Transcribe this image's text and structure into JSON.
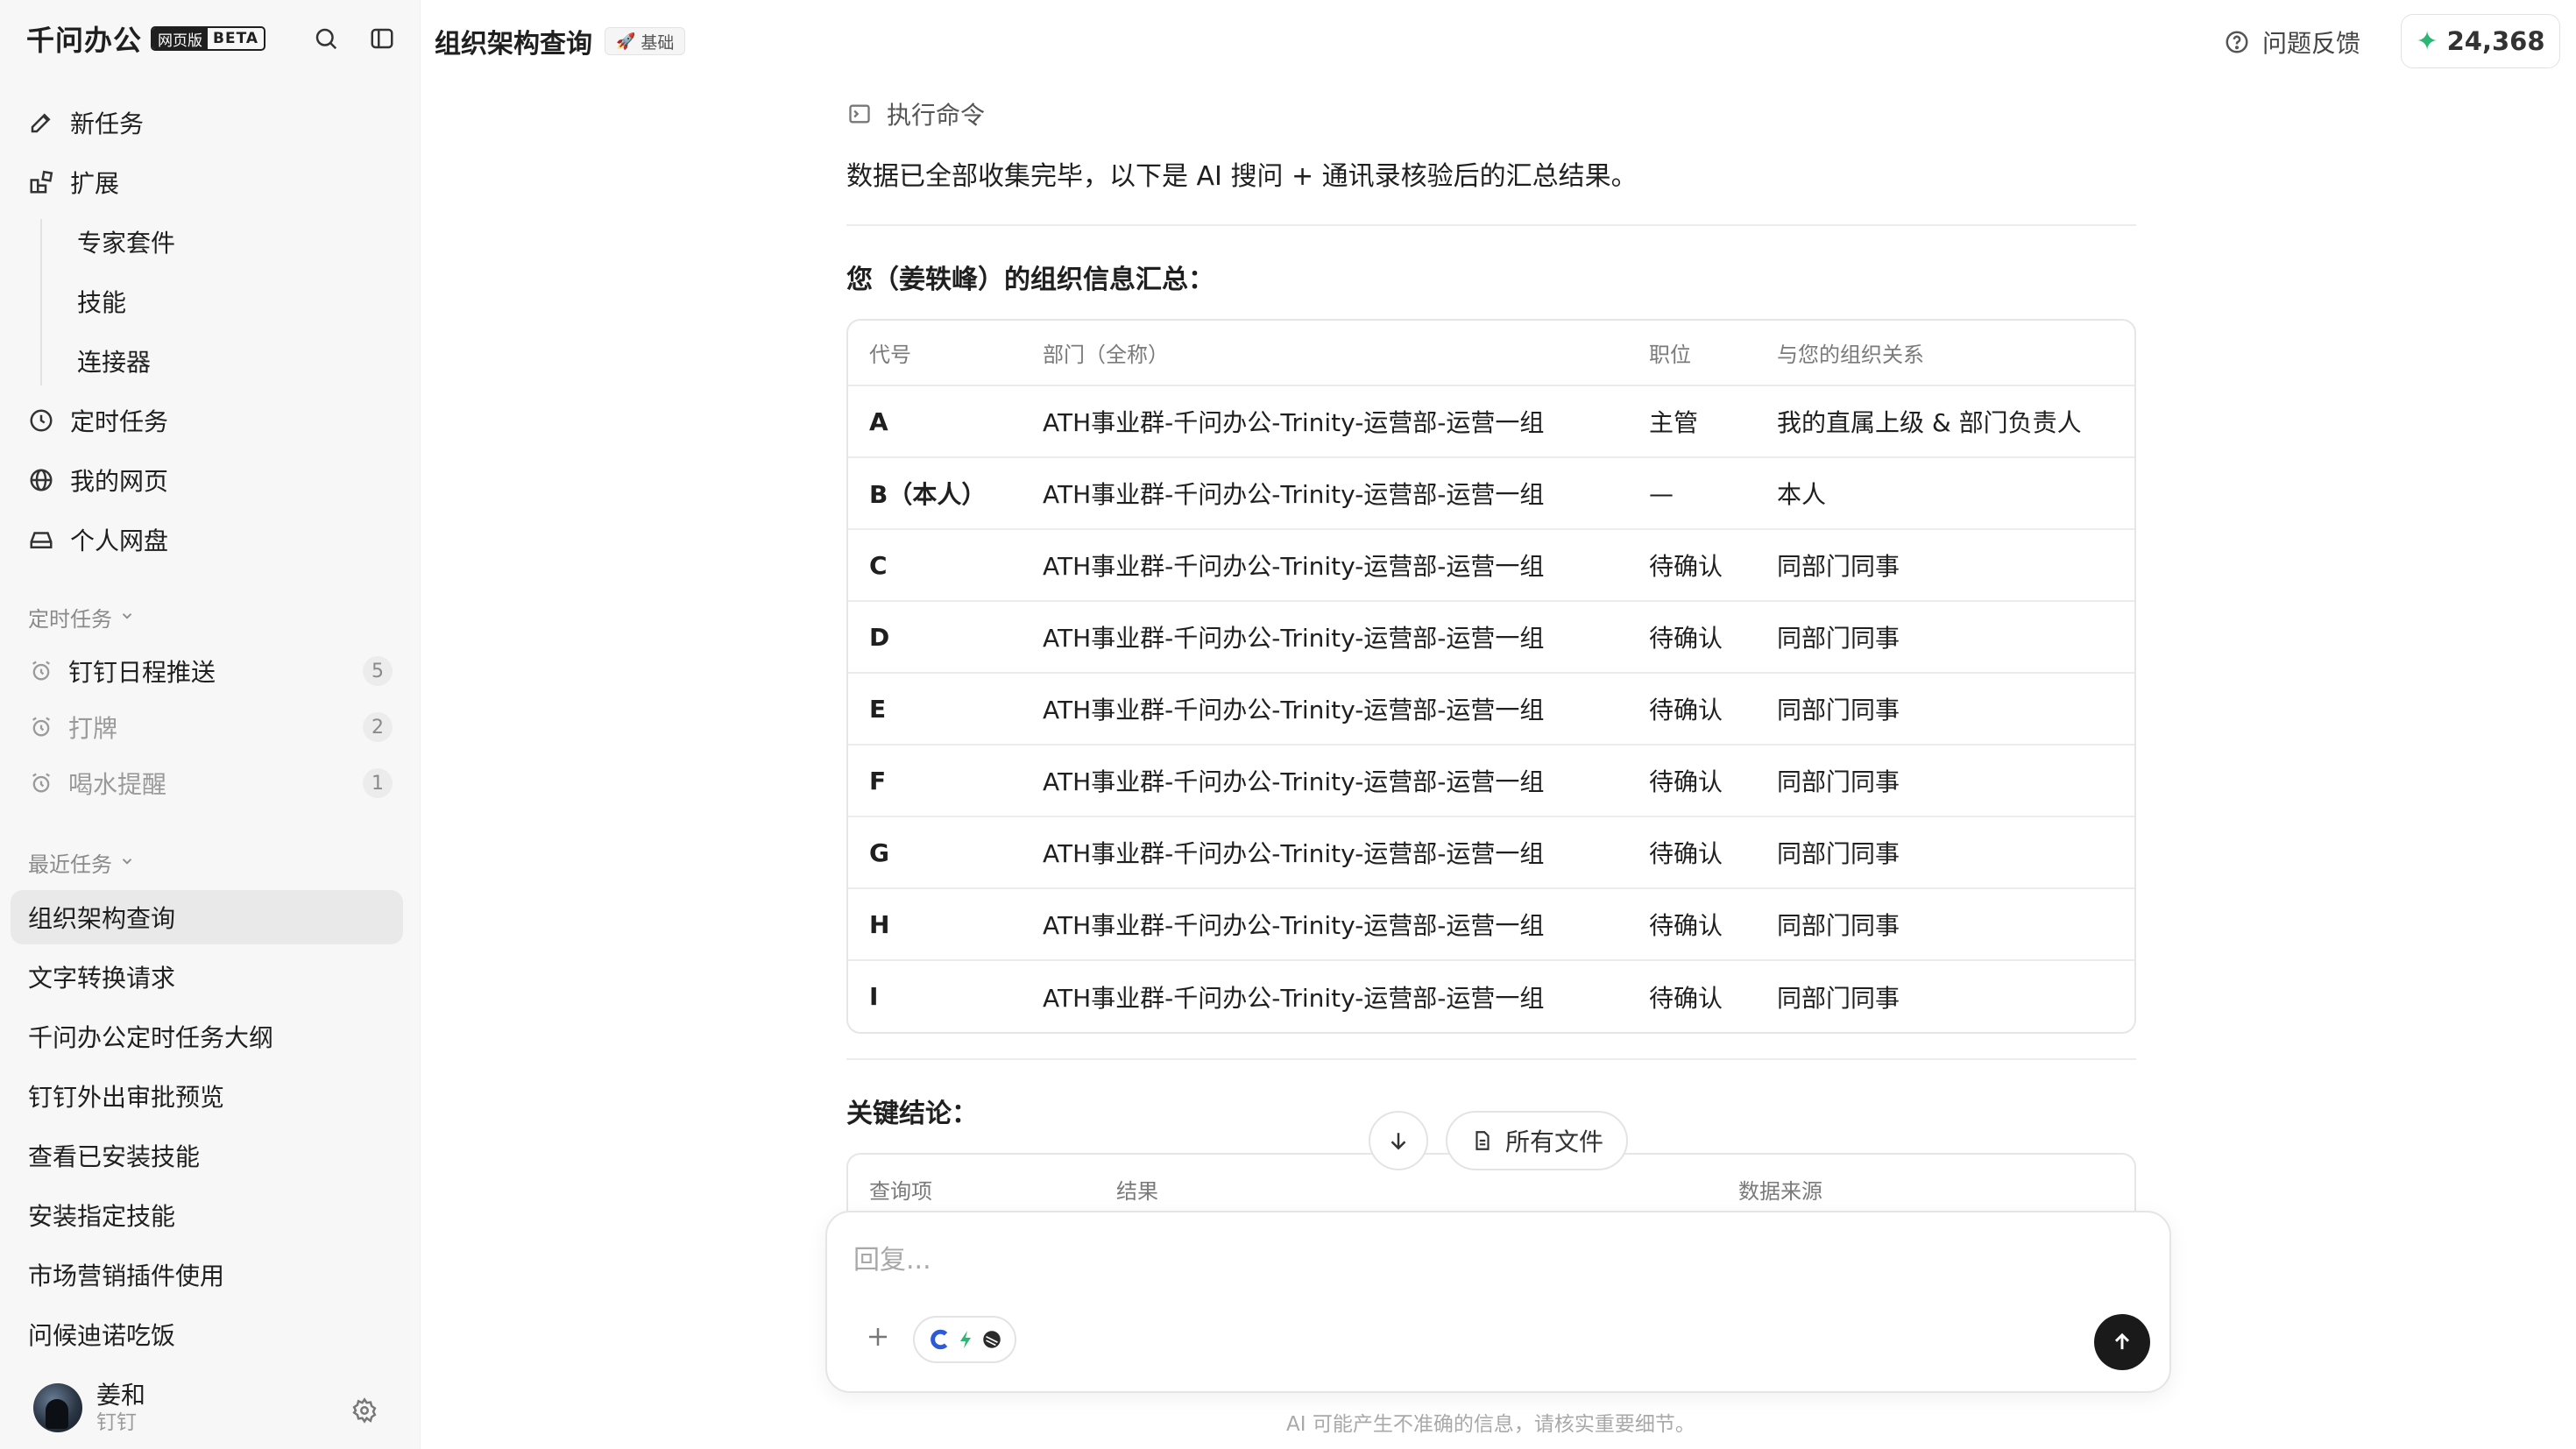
{
  "brand": {
    "name": "千问办公",
    "badge_left": "网页版",
    "badge_right": "BETA"
  },
  "nav": {
    "new_task": "新任务",
    "extensions": "扩展",
    "sub_items": [
      "专家套件",
      "技能",
      "连接器"
    ],
    "scheduled": "定时任务",
    "my_pages": "我的网页",
    "drive": "个人网盘"
  },
  "scheduled_section": {
    "title": "定时任务",
    "items": [
      {
        "label": "钉钉日程推送",
        "count": "5"
      },
      {
        "label": "打牌",
        "count": "2"
      },
      {
        "label": "喝水提醒",
        "count": "1"
      }
    ]
  },
  "recent_section": {
    "title": "最近任务",
    "items": [
      "组织架构查询",
      "文字转换请求",
      "千问办公定时任务大纲",
      "钉钉外出审批预览",
      "查看已安装技能",
      "安装指定技能",
      "市场营销插件使用",
      "问候迪诺吃饭"
    ]
  },
  "user": {
    "name": "姜和",
    "sub": "钉钉"
  },
  "header": {
    "title": "组织架构查询",
    "tag": "基础",
    "feedback": "问题反馈",
    "credits": "24,368"
  },
  "content": {
    "command_label": "执行命令",
    "intro": "数据已全部收集完毕，以下是 AI 搜问 + 通讯录核验后的汇总结果。",
    "summary_title": "您（姜轶峰）的组织信息汇总：",
    "table": {
      "headers": [
        "代号",
        "部门（全称）",
        "职位",
        "与您的组织关系"
      ],
      "rows": [
        [
          "A",
          "ATH事业群-千问办公-Trinity-运营部-运营一组",
          "主管",
          "我的直属上级 & 部门负责人"
        ],
        [
          "B（本人）",
          "ATH事业群-千问办公-Trinity-运营部-运营一组",
          "—",
          "本人"
        ],
        [
          "C",
          "ATH事业群-千问办公-Trinity-运营部-运营一组",
          "待确认",
          "同部门同事"
        ],
        [
          "D",
          "ATH事业群-千问办公-Trinity-运营部-运营一组",
          "待确认",
          "同部门同事"
        ],
        [
          "E",
          "ATH事业群-千问办公-Trinity-运营部-运营一组",
          "待确认",
          "同部门同事"
        ],
        [
          "F",
          "ATH事业群-千问办公-Trinity-运营部-运营一组",
          "待确认",
          "同部门同事"
        ],
        [
          "G",
          "ATH事业群-千问办公-Trinity-运营部-运营一组",
          "待确认",
          "同部门同事"
        ],
        [
          "H",
          "ATH事业群-千问办公-Trinity-运营部-运营一组",
          "待确认",
          "同部门同事"
        ],
        [
          "I",
          "ATH事业群-千问办公-Trinity-运营部-运营一组",
          "待确认",
          "同部门同事"
        ]
      ]
    },
    "conclusion_title": "关键结论：",
    "table2_headers": [
      "查询项",
      "结果",
      "数据来源"
    ]
  },
  "floating": {
    "all_files": "所有文件"
  },
  "composer": {
    "placeholder": "回复..."
  },
  "disclaimer": "AI 可能产生不准确的信息，请核实重要细节。",
  "colors": {
    "accent_green": "#2bb673",
    "send_button": "#1a1a1a",
    "sidebar_bg": "#f7f7f7"
  }
}
